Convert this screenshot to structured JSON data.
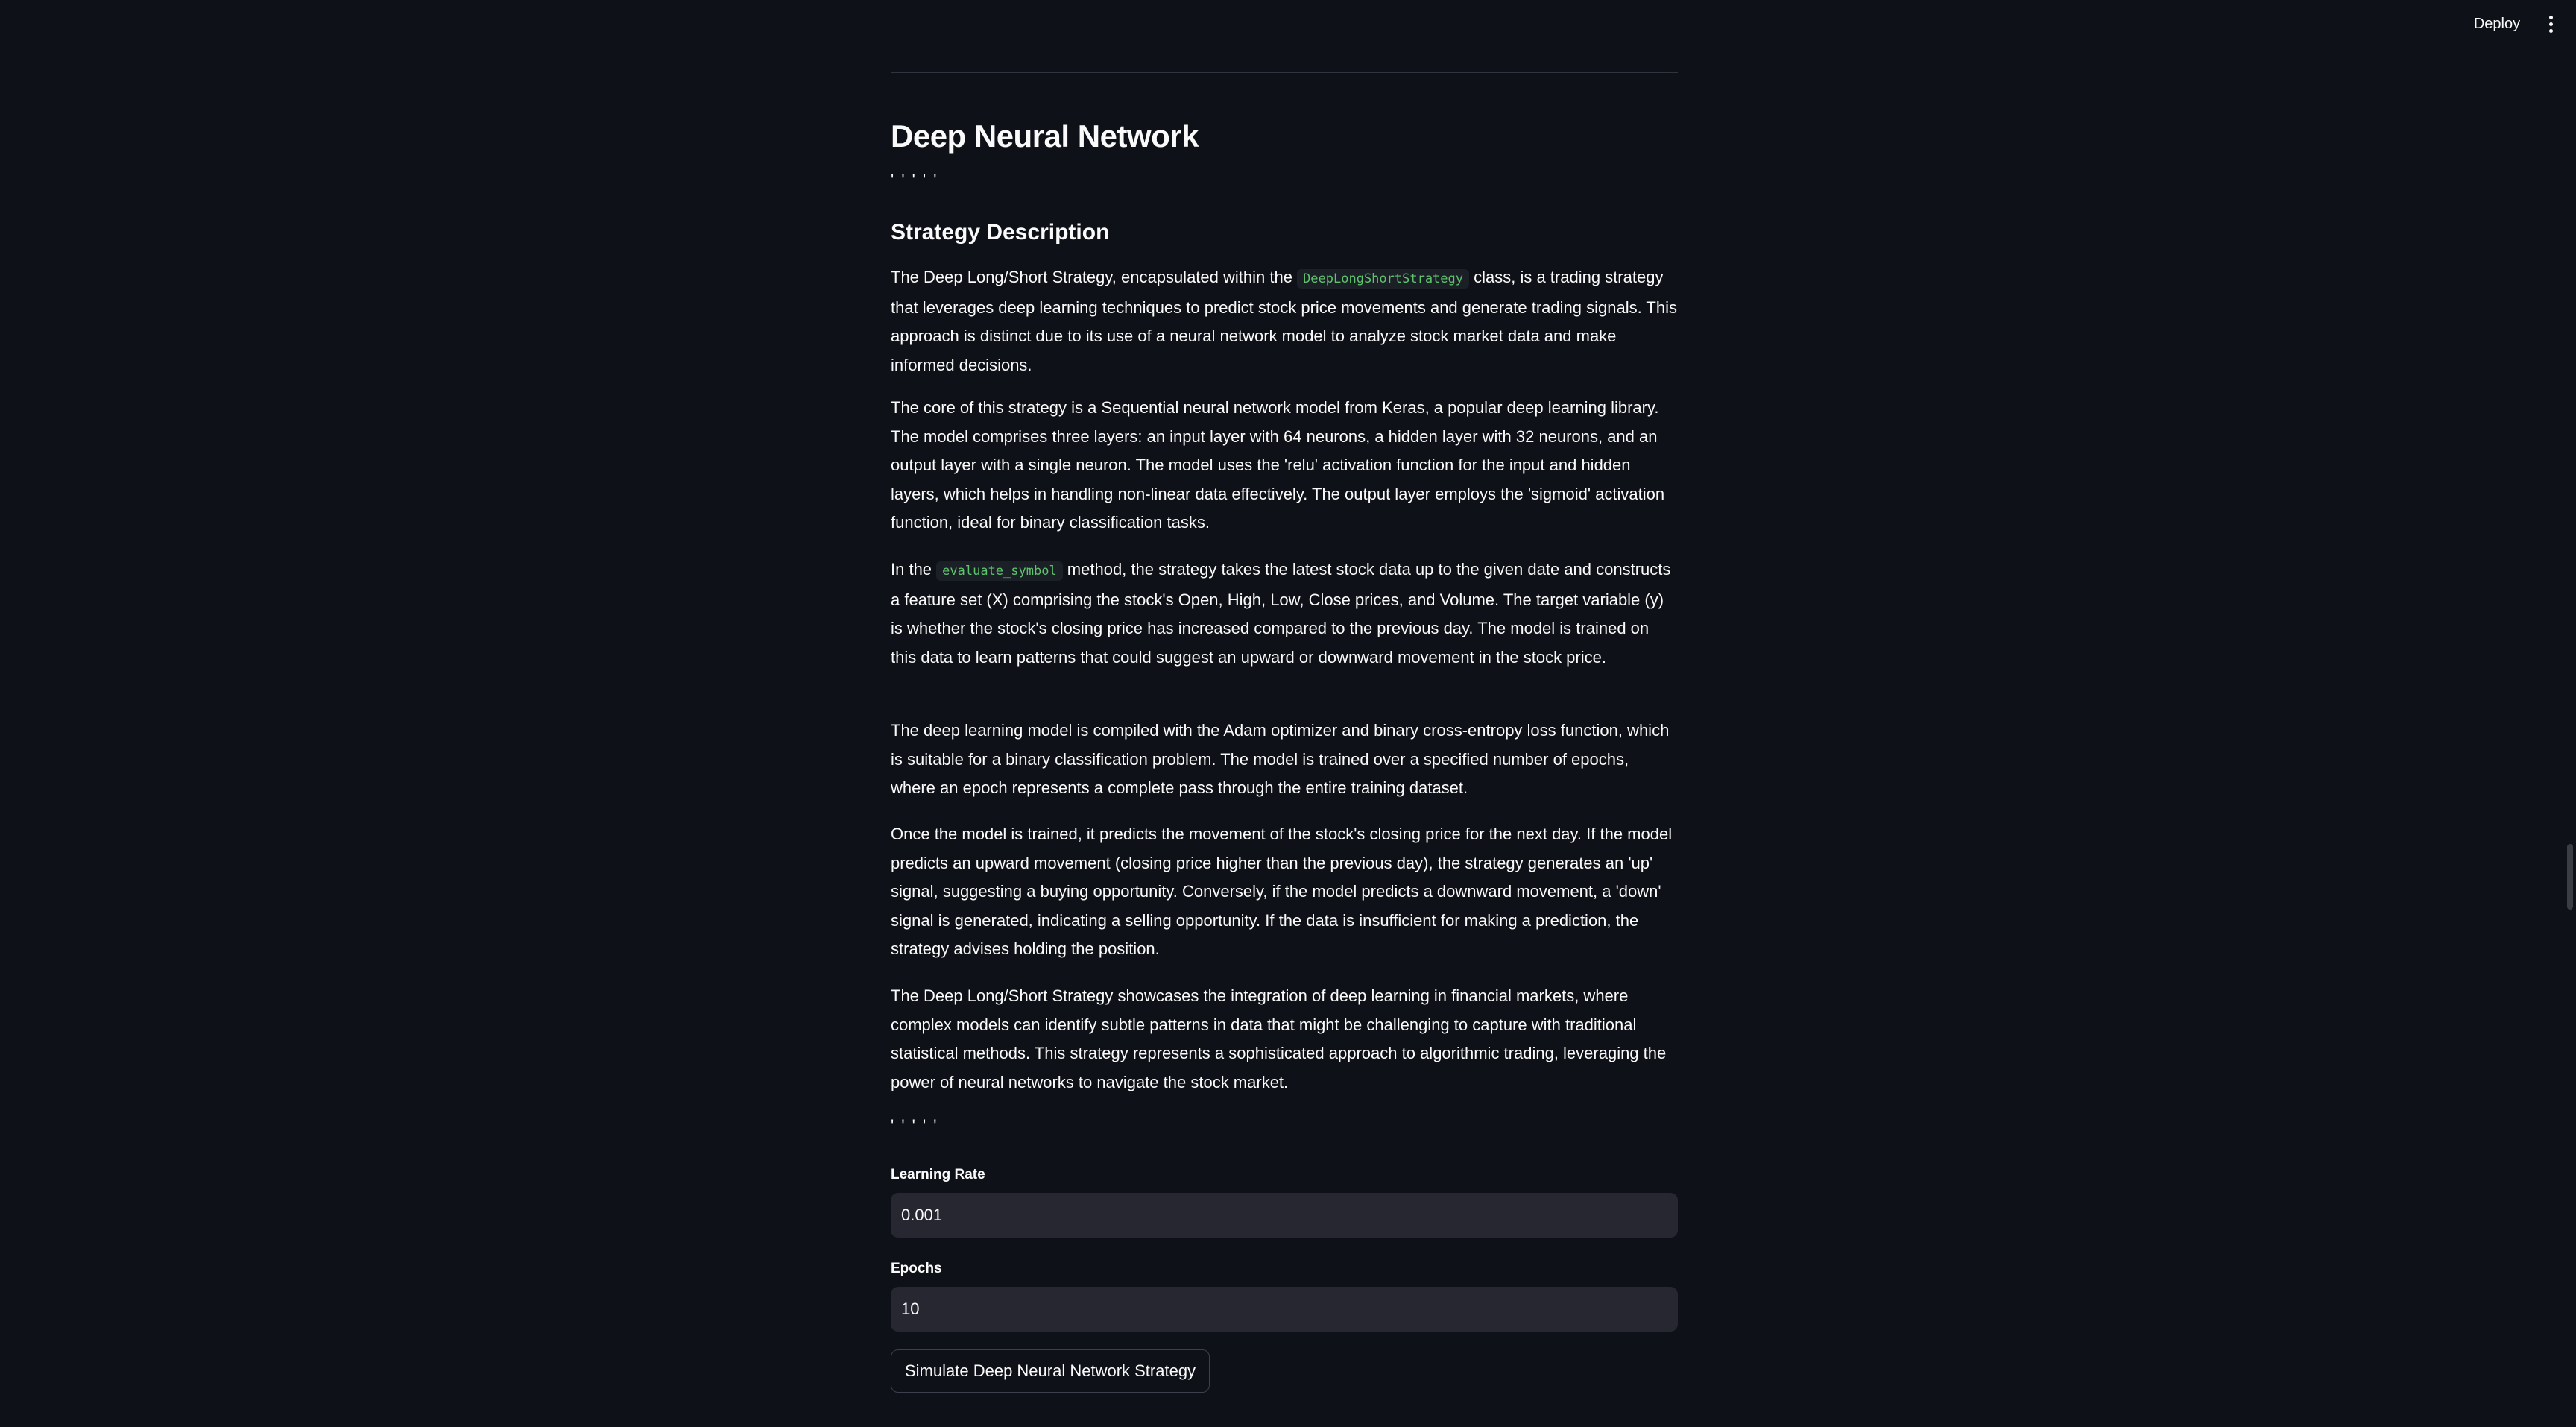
{
  "header": {
    "deploy_label": "Deploy",
    "menu_icon": "vertical-ellipsis-icon"
  },
  "main": {
    "title": "Deep Neural Network",
    "ticks_top": "' ' ' ' '",
    "section_heading": "Strategy Description",
    "p1_before_code": "The Deep Long/Short Strategy, encapsulated within the ",
    "p1_code": "DeepLongShortStrategy",
    "p1_after_code": " class, is a trading strategy that leverages deep learning techniques to predict stock price movements and generate trading signals. This approach is distinct due to its use of a neural network model to analyze stock market data and make informed decisions.",
    "p2": "The core of this strategy is a Sequential neural network model from Keras, a popular deep learning library. The model comprises three layers: an input layer with 64 neurons, a hidden layer with 32 neurons, and an output layer with a single neuron. The model uses the 'relu' activation function for the input and hidden layers, which helps in handling non-linear data effectively. The output layer employs the 'sigmoid' activation function, ideal for binary classification tasks.",
    "p3_before_code": "In the ",
    "p3_code": "evaluate_symbol",
    "p3_after_code": " method, the strategy takes the latest stock data up to the given date and constructs a feature set (X) comprising the stock's Open, High, Low, Close prices, and Volume. The target variable (y) is whether the stock's closing price has increased compared to the previous day. The model is trained on this data to learn patterns that could suggest an upward or downward movement in the stock price.",
    "p4": "The deep learning model is compiled with the Adam optimizer and binary cross-entropy loss function, which is suitable for a binary classification problem. The model is trained over a specified number of epochs, where an epoch represents a complete pass through the entire training dataset.",
    "p5": "Once the model is trained, it predicts the movement of the stock's closing price for the next day. If the model predicts an upward movement (closing price higher than the previous day), the strategy generates an 'up' signal, suggesting a buying opportunity. Conversely, if the model predicts a downward movement, a 'down' signal is generated, indicating a selling opportunity. If the data is insufficient for making a prediction, the strategy advises holding the position.",
    "p6": "The Deep Long/Short Strategy showcases the integration of deep learning in financial markets, where complex models can identify subtle patterns in data that might be challenging to capture with traditional statistical methods. This strategy represents a sophisticated approach to algorithmic trading, leveraging the power of neural networks to navigate the stock market.",
    "ticks_bottom": "' ' ' ' '"
  },
  "form": {
    "learning_rate_label": "Learning Rate",
    "learning_rate_value": "0.001",
    "epochs_label": "Epochs",
    "epochs_value": "10",
    "simulate_label": "Simulate Deep Neural Network Strategy"
  }
}
